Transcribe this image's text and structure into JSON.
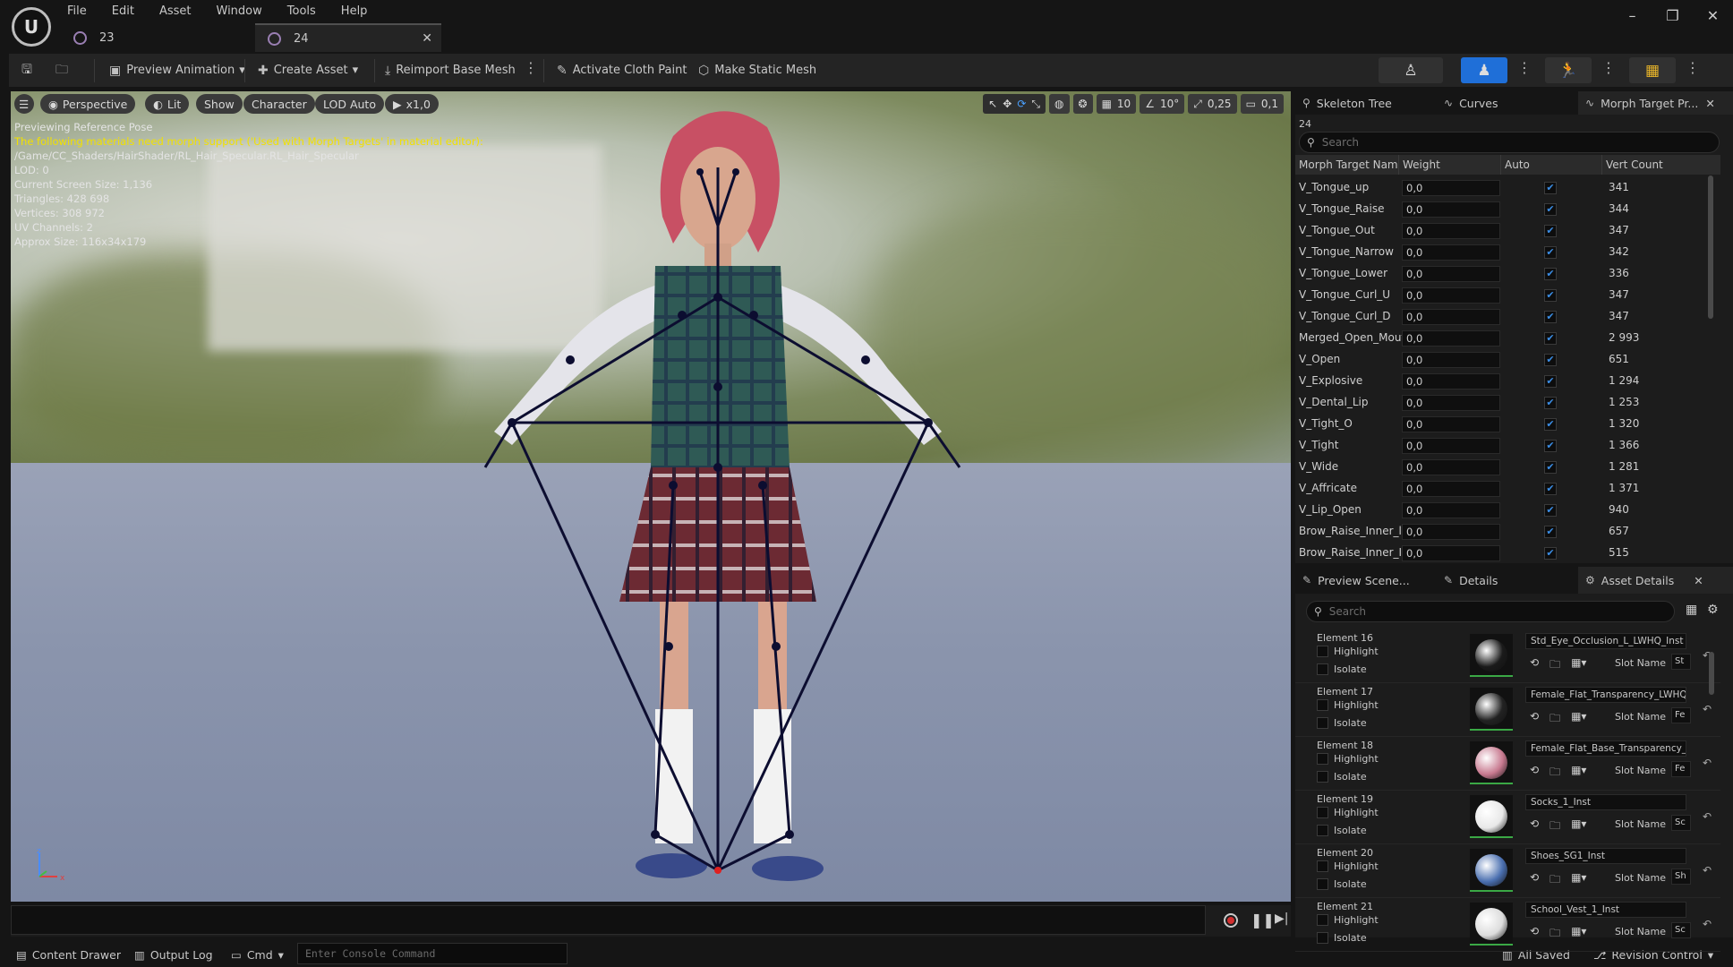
{
  "menu": [
    "File",
    "Edit",
    "Asset",
    "Window",
    "Tools",
    "Help"
  ],
  "tabs": [
    {
      "label": "23"
    },
    {
      "label": "24"
    }
  ],
  "window_controls": [
    "–",
    "❐",
    "✕"
  ],
  "toolbar": {
    "preview_animation": "Preview Animation",
    "create_asset": "Create Asset",
    "reimport": "Reimport Base Mesh",
    "cloth_paint": "Activate Cloth Paint",
    "static_mesh": "Make Static Mesh"
  },
  "viewport": {
    "perspective": "Perspective",
    "lit": "Lit",
    "show": "Show",
    "character": "Character",
    "lod": "LOD Auto",
    "speed": "x1,0",
    "grid_value": "10",
    "angle_value": "10°",
    "scale_value": "0,25",
    "camera_value": "0,1",
    "info": [
      {
        "text": "Previewing Reference Pose",
        "warn": false
      },
      {
        "text": "The following materials need morph support ('Used with Morph Targets' in material editor):",
        "warn": true
      },
      {
        "text": "/Game/CC_Shaders/HairShader/RL_Hair_Specular.RL_Hair_Specular",
        "warn": false
      },
      {
        "text": "LOD: 0",
        "warn": false
      },
      {
        "text": "Current Screen Size: 1,136",
        "warn": false
      },
      {
        "text": "Triangles: 428 698",
        "warn": false
      },
      {
        "text": "Vertices: 308 972",
        "warn": false
      },
      {
        "text": "UV Channels: 2",
        "warn": false
      },
      {
        "text": "Approx Size: 116x34x179",
        "warn": false
      }
    ]
  },
  "status": {
    "content_drawer": "Content Drawer",
    "output_log": "Output Log",
    "cmd": "Cmd",
    "console_placeholder": "Enter Console Command",
    "all_saved": "All Saved",
    "revision": "Revision Control"
  },
  "morph_panel": {
    "tabs": [
      "Skeleton Tree",
      "Curves",
      "Morph Target Pr..."
    ],
    "asset_name": "24",
    "search_placeholder": "Search",
    "columns": [
      "Morph Target Nam",
      "Weight",
      "Auto",
      "Vert Count"
    ],
    "rows": [
      {
        "name": "V_Tongue_up",
        "weight": "0,0",
        "vc": "341"
      },
      {
        "name": "V_Tongue_Raise",
        "weight": "0,0",
        "vc": "344"
      },
      {
        "name": "V_Tongue_Out",
        "weight": "0,0",
        "vc": "347"
      },
      {
        "name": "V_Tongue_Narrow",
        "weight": "0,0",
        "vc": "342"
      },
      {
        "name": "V_Tongue_Lower",
        "weight": "0,0",
        "vc": "336"
      },
      {
        "name": "V_Tongue_Curl_U",
        "weight": "0,0",
        "vc": "347"
      },
      {
        "name": "V_Tongue_Curl_D",
        "weight": "0,0",
        "vc": "347"
      },
      {
        "name": "Merged_Open_Mout",
        "weight": "0,0",
        "vc": "2 993"
      },
      {
        "name": "V_Open",
        "weight": "0,0",
        "vc": "651"
      },
      {
        "name": "V_Explosive",
        "weight": "0,0",
        "vc": "1 294"
      },
      {
        "name": "V_Dental_Lip",
        "weight": "0,0",
        "vc": "1 253"
      },
      {
        "name": "V_Tight_O",
        "weight": "0,0",
        "vc": "1 320"
      },
      {
        "name": "V_Tight",
        "weight": "0,0",
        "vc": "1 366"
      },
      {
        "name": "V_Wide",
        "weight": "0,0",
        "vc": "1 281"
      },
      {
        "name": "V_Affricate",
        "weight": "0,0",
        "vc": "1 371"
      },
      {
        "name": "V_Lip_Open",
        "weight": "0,0",
        "vc": "940"
      },
      {
        "name": "Brow_Raise_Inner_l",
        "weight": "0,0",
        "vc": "657"
      },
      {
        "name": "Brow_Raise_Inner_I",
        "weight": "0,0",
        "vc": "515"
      }
    ]
  },
  "details_panel": {
    "tabs": [
      "Preview Scene...",
      "Details",
      "Asset Details"
    ],
    "search_placeholder": "Search",
    "highlight": "Highlight",
    "isolate": "Isolate",
    "slot_label": "Slot Name",
    "elements": [
      {
        "name": "Element 16",
        "material": "Std_Eye_Occlusion_L_LWHQ_Inst",
        "slot": "St",
        "thumb": "#1a1a1a"
      },
      {
        "name": "Element 17",
        "material": "Female_Flat_Transparency_LWHQ",
        "slot": "Fe",
        "thumb": "#222"
      },
      {
        "name": "Element 18",
        "material": "Female_Flat_Base_Transparency_",
        "slot": "Fe",
        "thumb": "#c87a90"
      },
      {
        "name": "Element 19",
        "material": "Socks_1_Inst",
        "slot": "Sc",
        "thumb": "#e8e8e8"
      },
      {
        "name": "Element 20",
        "material": "Shoes_SG1_Inst",
        "slot": "Sh",
        "thumb": "#4a6fb0"
      },
      {
        "name": "Element 21",
        "material": "School_Vest_1_Inst",
        "slot": "Sc",
        "thumb": "#dcdcdc"
      }
    ]
  }
}
